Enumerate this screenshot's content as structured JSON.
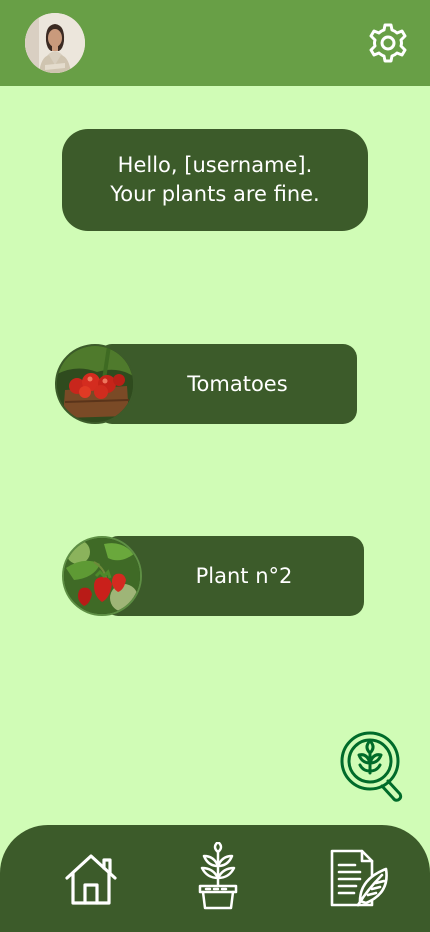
{
  "header": {
    "avatar_icon": "user-avatar-photo",
    "settings_icon": "gear-icon"
  },
  "greeting": {
    "line1": "Hello, [username].",
    "line2": "Your plants are fine."
  },
  "plants": [
    {
      "label": "Tomatoes",
      "icon": "tomato-photo"
    },
    {
      "label": "Plant n°2",
      "icon": "strawberry-photo"
    }
  ],
  "actions": {
    "scan_icon": "plant-search-icon"
  },
  "bottom_nav": {
    "items": [
      {
        "icon": "home-icon"
      },
      {
        "icon": "potted-plant-icon"
      },
      {
        "icon": "leaf-document-icon"
      }
    ]
  },
  "colors": {
    "background": "#d0fcb6",
    "header": "#689f46",
    "dark_green": "#3c5b2a",
    "icon_green": "#006b2a"
  }
}
